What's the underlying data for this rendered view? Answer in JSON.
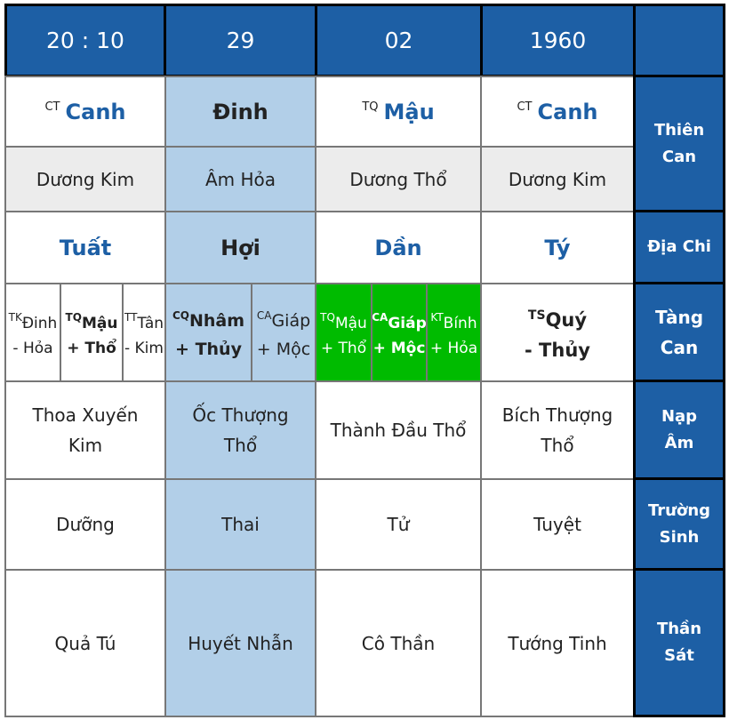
{
  "header": {
    "hour": "20 : 10",
    "day": "29",
    "month": "02",
    "year": "1960",
    "corner": ""
  },
  "labels": {
    "thien_can": [
      "Thiên",
      "Can"
    ],
    "dia_chi": "Địa Chi",
    "tang_can": [
      "Tàng",
      "Can"
    ],
    "nap_am": [
      "Nạp",
      "Âm"
    ],
    "truong_sinh": [
      "Trường",
      "Sinh"
    ],
    "than_sat": [
      "Thần",
      "Sát"
    ]
  },
  "columns": [
    {
      "key": "hour",
      "stem": {
        "tag": "CT",
        "name": "Canh"
      },
      "element": "Dương Kim",
      "branch": "Tuất",
      "hidden_stems": [
        {
          "tag": "TK",
          "name": "Đinh",
          "element": "- Hỏa",
          "bold": false
        },
        {
          "tag": "TQ",
          "name": "Mậu",
          "element": "+ Thổ",
          "bold": true
        },
        {
          "tag": "TT",
          "name": "Tân",
          "element": "- Kim",
          "bold": false
        }
      ],
      "nap_am": "Thoa Xuyến Kim",
      "truong_sinh": "Dưỡng",
      "than_sat": "Quả Tú"
    },
    {
      "key": "day",
      "highlighted": true,
      "stem": {
        "tag": "",
        "name": "Đinh"
      },
      "element": "Âm Hỏa",
      "branch": "Hợi",
      "hidden_stems": [
        {
          "tag": "CQ",
          "name": "Nhâm",
          "element": "+ Thủy",
          "bold": true
        },
        {
          "tag": "CA",
          "name": "Giáp",
          "element": "+ Mộc",
          "bold": false
        }
      ],
      "nap_am": "Ốc Thượng Thổ",
      "truong_sinh": "Thai",
      "than_sat": "Huyết Nhẫn"
    },
    {
      "key": "month",
      "stem": {
        "tag": "TQ",
        "name": "Mậu"
      },
      "element": "Dương Thổ",
      "branch": "Dần",
      "hidden_stems": [
        {
          "tag": "TQ",
          "name": "Mậu",
          "element": "+ Thổ",
          "bold": false
        },
        {
          "tag": "CA",
          "name": "Giáp",
          "element": "+ Mộc",
          "bold": true
        },
        {
          "tag": "KT",
          "name": "Bính",
          "element": "+ Hỏa",
          "bold": false
        }
      ],
      "hidden_stem_color": "#00bb00",
      "nap_am": "Thành Đầu Thổ",
      "truong_sinh": "Tử",
      "than_sat": "Cô Thần"
    },
    {
      "key": "year",
      "stem": {
        "tag": "CT",
        "name": "Canh"
      },
      "element": "Dương Kim",
      "branch": "Tý",
      "hidden_stems": [
        {
          "tag": "TS",
          "name": "Quý",
          "element": "- Thủy",
          "bold": true
        }
      ],
      "nap_am": "Bích Thượng Thổ",
      "truong_sinh": "Tuyệt",
      "than_sat": "Tướng Tinh"
    }
  ],
  "colors": {
    "header_bg": "#1d5fa5",
    "day_highlight": "#b2cfe8",
    "element_row_bg": "#ececec",
    "month_hidden_bg": "#00bb00",
    "stem_text": "#1d5fa5"
  }
}
